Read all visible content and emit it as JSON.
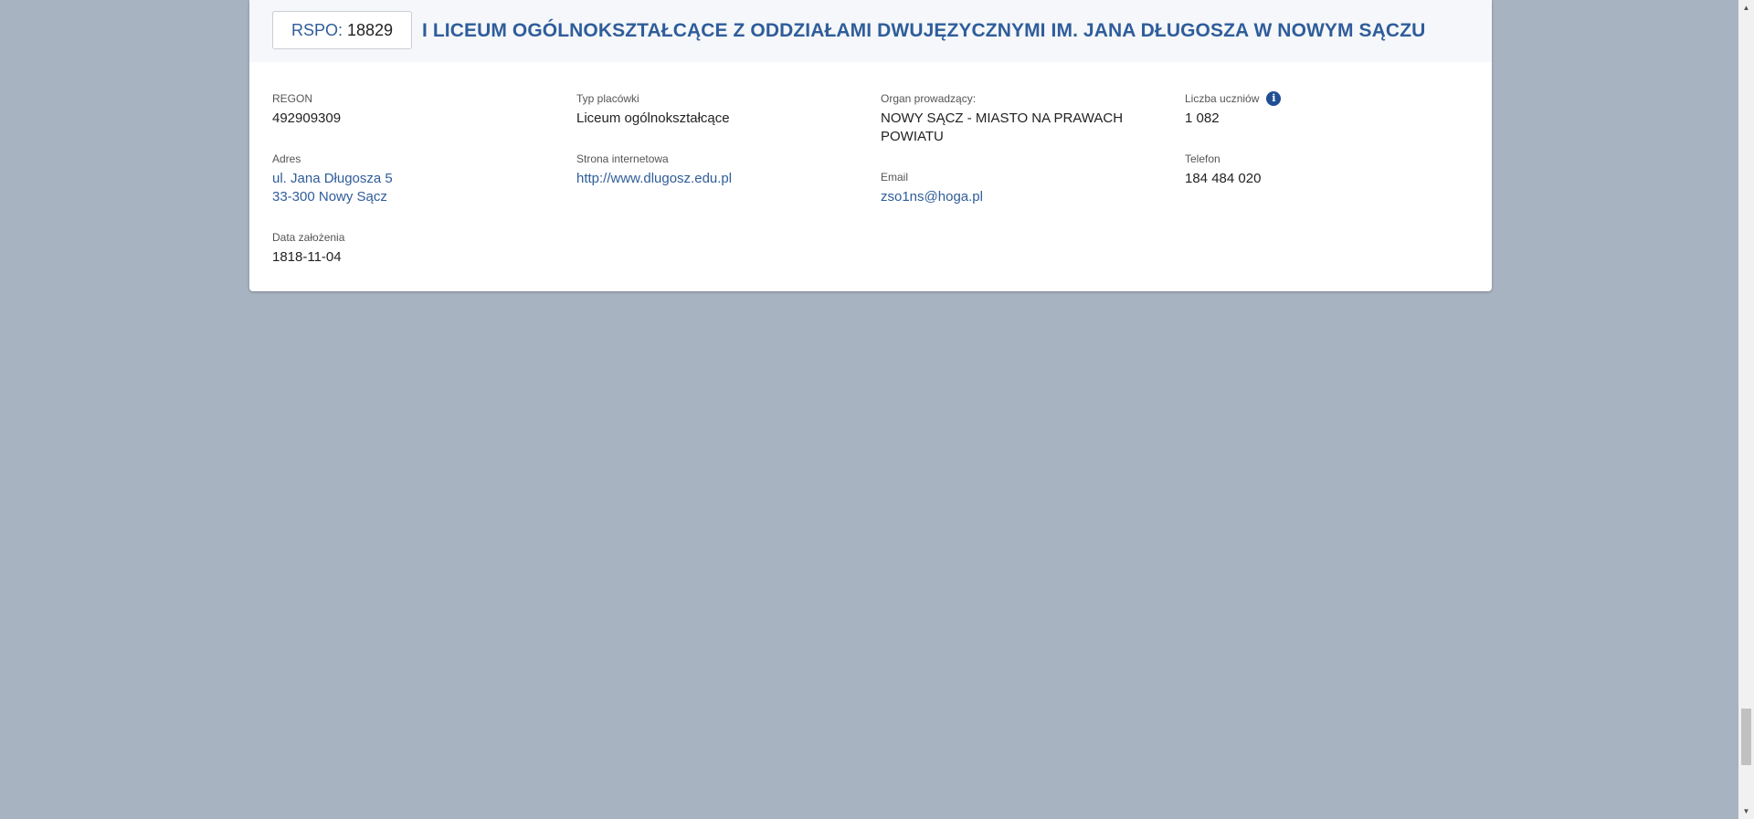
{
  "header": {
    "rspo_label": "RSPO:",
    "rspo_value": "18829",
    "school_name": "I LICEUM OGÓLNOKSZTAŁCĄCE Z ODDZIAŁAMI DWUJĘZYCZNYMI IM. JANA DŁUGOSZA W NOWYM SĄCZU"
  },
  "col1": {
    "regon_label": "REGON",
    "regon_value": "492909309",
    "address_label": "Adres",
    "address_line1": "ul. Jana Długosza 5",
    "address_line2": "33-300 Nowy Sącz",
    "founded_label": "Data założenia",
    "founded_value": "1818-11-04"
  },
  "col2": {
    "type_label": "Typ placówki",
    "type_value": "Liceum ogólnokształcące",
    "website_label": "Strona internetowa",
    "website_value": "http://www.dlugosz.edu.pl"
  },
  "col3": {
    "organ_label": "Organ prowadzący:",
    "organ_value_line1": "NOWY SĄCZ - MIASTO NA PRAWACH",
    "organ_value_line2": "POWIATU",
    "email_label": "Email",
    "email_value": "zso1ns@hoga.pl"
  },
  "col4": {
    "students_label": "Liczba uczniów",
    "students_info_glyph": "i",
    "students_value": "1 082",
    "phone_label": "Telefon",
    "phone_value": "184 484 020"
  },
  "scrollbar": {
    "up_glyph": "▲",
    "down_glyph": "▼",
    "position": 0.95
  },
  "colors": {
    "background": "#a8b3c1",
    "accent": "#2f5d9a",
    "info_icon": "#1f4e93"
  }
}
